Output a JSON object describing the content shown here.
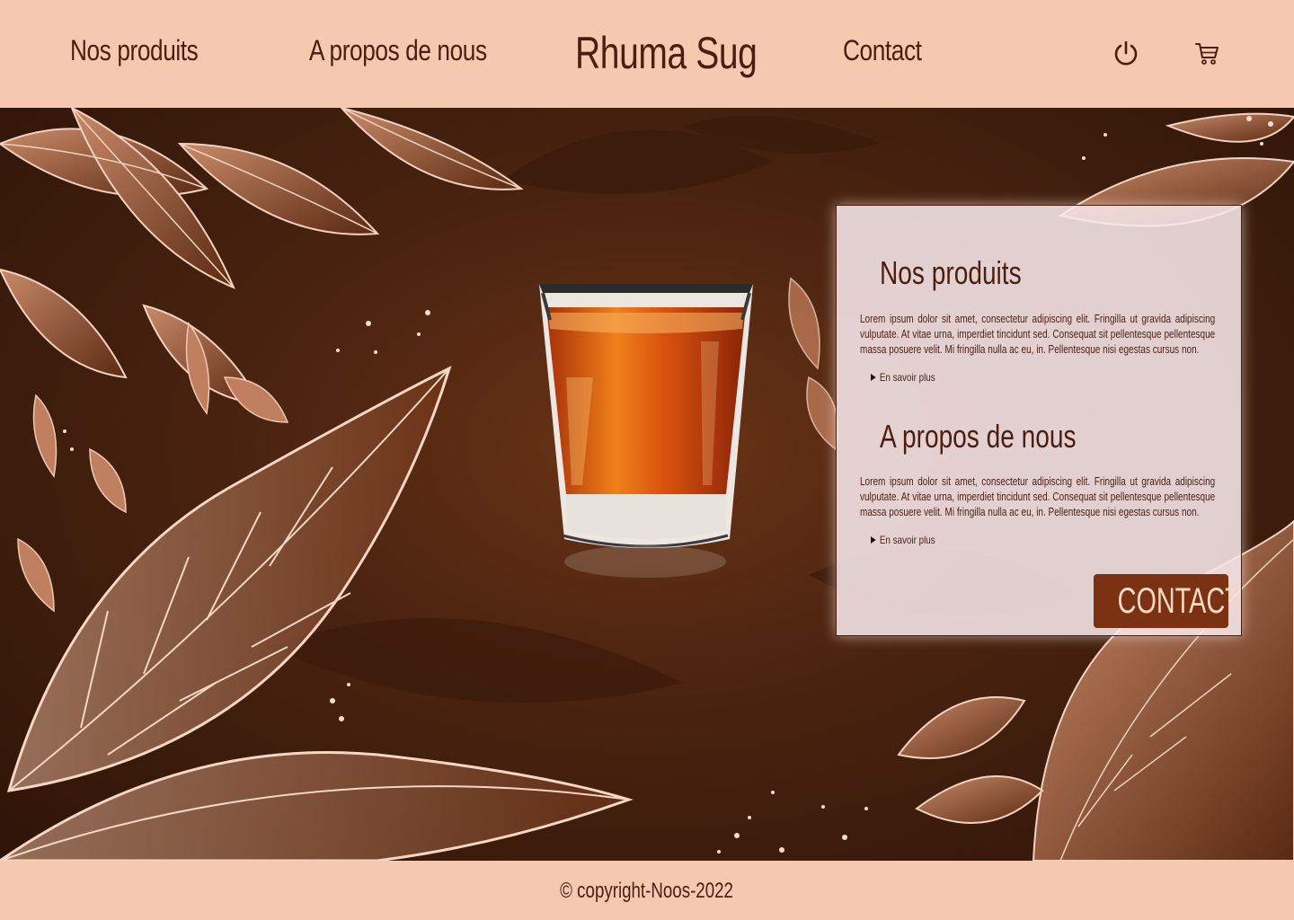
{
  "header": {
    "brand": "Rhuma Sug",
    "nav": {
      "products": "Nos produits",
      "about": "A propos de nous",
      "contact": "Contact"
    },
    "icons": [
      "power-icon",
      "cart-icon"
    ]
  },
  "colors": {
    "background": "#f5c8b0",
    "text": "#4a1e10",
    "button": "#7a3212",
    "button_text": "#f7d9c6"
  },
  "card": {
    "sections": [
      {
        "title": "Nos produits",
        "text": "Lorem ipsum dolor sit amet, consectetur adipiscing elit. Fringilla ut gravida adipiscing vulputate. At vitae urna, imperdiet tincidunt sed. Consequat sit pellentesque pellentesque massa posuere velit. Mi fringilla nulla ac eu, in. Pellentesque nisi egestas cursus non.",
        "more": "En savoir plus"
      },
      {
        "title": "A propos de nous",
        "text": "Lorem ipsum dolor sit amet, consectetur adipiscing elit. Fringilla ut gravida adipiscing vulputate. At vitae urna, imperdiet tincidunt sed. Consequat sit pellentesque pellentesque massa posuere velit. Mi fringilla nulla ac eu, in. Pellentesque nisi egestas cursus non.",
        "more": "En savoir plus"
      }
    ],
    "contact_button": "CONTACT"
  },
  "footer": {
    "copyright": "© copyright-Noos-2022"
  }
}
